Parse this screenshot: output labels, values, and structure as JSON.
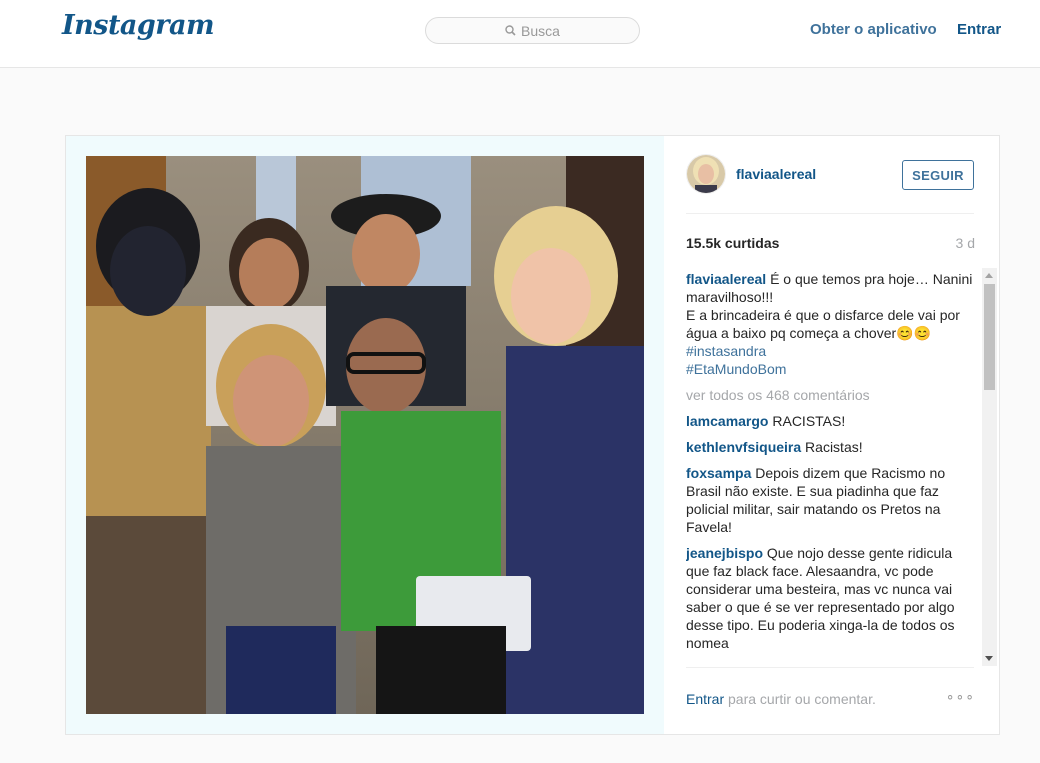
{
  "header": {
    "logo": "Instagram",
    "search_placeholder": "Busca",
    "get_app": "Obter o aplicativo",
    "login": "Entrar"
  },
  "post": {
    "username": "flaviaalereal",
    "follow_label": "SEGUIR",
    "likes": "15.5k curtidas",
    "time": "3 d",
    "caption": {
      "user": "flaviaalereal",
      "lines": [
        "É o que temos pra hoje… Nanini maravilhoso!!!",
        "E a brincadeira é que o disfarce dele vai por água a baixo pq começa a chover😊😊"
      ],
      "tags": [
        "#instasandra",
        "#EtaMundoBom"
      ]
    },
    "view_all": "ver todos os 468 comentários",
    "comments": [
      {
        "user": "lamcamargo",
        "text": "RACISTAS!"
      },
      {
        "user": "kethlenvfsiqueira",
        "text": "Racistas!"
      },
      {
        "user": "foxsampa",
        "text": "Depois dizem que Racismo no Brasil não existe. E sua piadinha que faz policial militar, sair matando os Pretos na Favela!"
      },
      {
        "user": "jeanejbispo",
        "text": "Que nojo desse gente ridicula que faz black face. Alesaandra, vc pode considerar uma besteira, mas vc nunca vai saber o que é se ver representado por algo desse tipo. Eu poderia xinga-la de todos os nomea"
      }
    ],
    "login_prompt_link": "Entrar",
    "login_prompt_rest": " para curtir ou comentar.",
    "more": "∘∘∘"
  },
  "colors": {
    "brand": "#125688",
    "link": "#3f729b",
    "muted": "#a5a7aa"
  },
  "icons": [
    "search-icon",
    "more-options-icon"
  ]
}
